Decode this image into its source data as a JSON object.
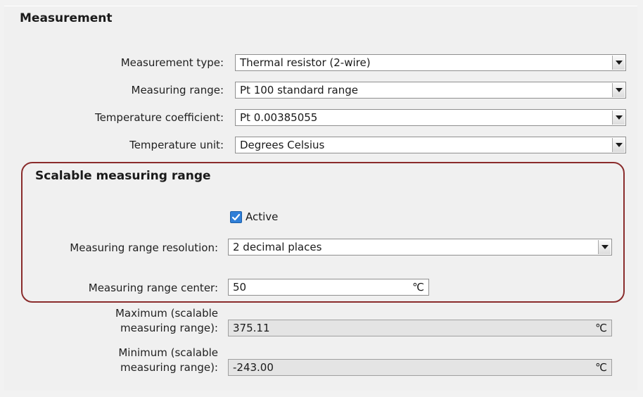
{
  "section": {
    "title": "Measurement"
  },
  "measurement": {
    "type_label": "Measurement type:",
    "type_value": "Thermal resistor (2-wire)",
    "range_label": "Measuring range:",
    "range_value": "Pt 100 standard range",
    "coeff_label": "Temperature coefficient:",
    "coeff_value": "Pt 0.00385055",
    "unit_label": "Temperature unit:",
    "unit_value": "Degrees Celsius"
  },
  "scalable": {
    "title": "Scalable measuring range",
    "active_label": "Active",
    "active_checked": true,
    "resolution_label": "Measuring range resolution:",
    "resolution_value": "2 decimal places",
    "center_label": "Measuring range center:",
    "center_value": "50",
    "center_unit": "℃"
  },
  "limits": {
    "max_label_line1": "Maximum (scalable",
    "max_label_line2": "measuring range):",
    "max_value": "375.11",
    "max_unit": "℃",
    "min_label_line1": "Minimum (scalable",
    "min_label_line2": "measuring range):",
    "min_value": "-243.00",
    "min_unit": "℃"
  },
  "colors": {
    "highlight_border": "#8a2c2c",
    "checkbox_accent": "#2f7fd8"
  }
}
